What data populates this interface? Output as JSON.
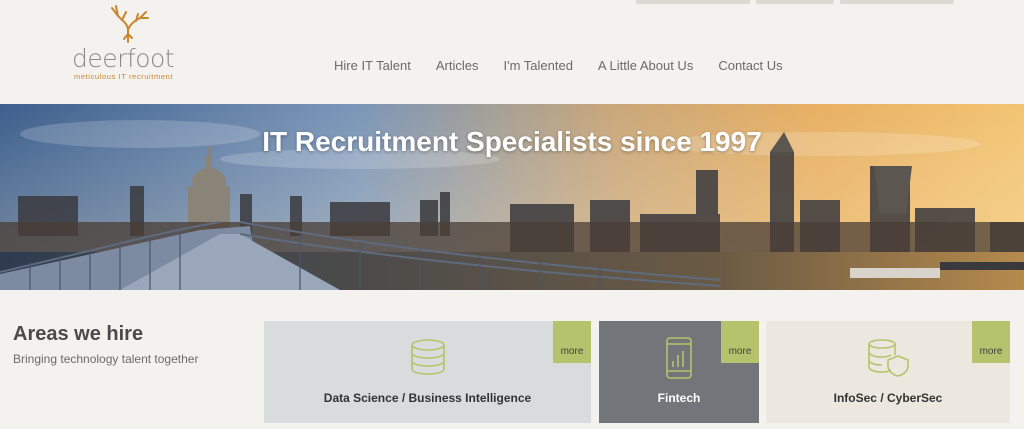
{
  "brand": {
    "name": "deerfoot",
    "tagline": "meticulous IT recruitment",
    "colors": {
      "name": "#8a8a8a",
      "tagline": "#c9862c",
      "antler": "#c9862c"
    }
  },
  "nav": {
    "items": [
      {
        "label": "Hire IT Talent"
      },
      {
        "label": "Articles"
      },
      {
        "label": "I'm Talented"
      },
      {
        "label": "A Little About Us"
      },
      {
        "label": "Contact Us"
      }
    ]
  },
  "hero": {
    "title": "IT Recruitment Specialists since 1997"
  },
  "areas": {
    "title": "Areas we hire",
    "subtitle": "Bringing technology talent together",
    "cards": [
      {
        "label": "Data Science / Business Intelligence",
        "more": "more",
        "icon": "database-icon",
        "bg": "#d8dcdd",
        "text_color": "#333333"
      },
      {
        "label": "Fintech",
        "more": "more",
        "icon": "mobile-chart-icon",
        "bg": "#727579",
        "text_color": "#ffffff"
      },
      {
        "label": "InfoSec / CyberSec",
        "more": "more",
        "icon": "database-shield-icon",
        "bg": "#ece7df",
        "text_color": "#333333"
      }
    ],
    "accent": "#b5c46c"
  }
}
